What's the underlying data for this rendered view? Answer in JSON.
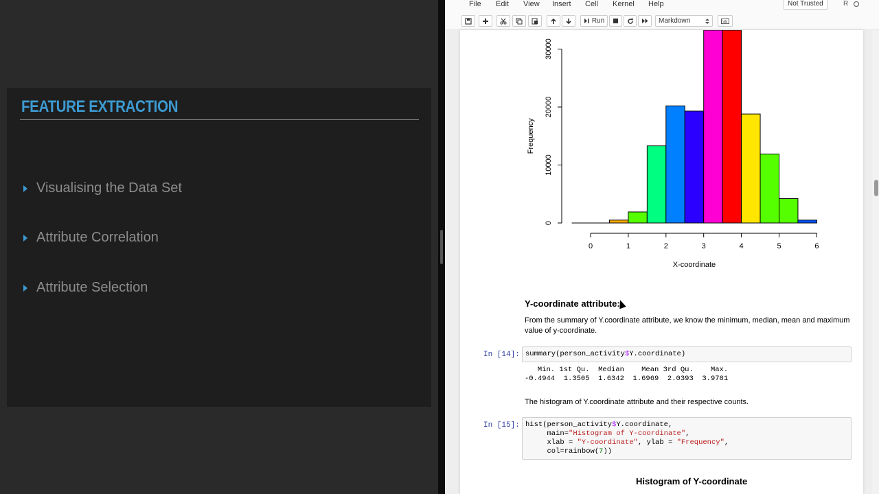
{
  "slide": {
    "title": "FEATURE EXTRACTION",
    "bullets": [
      "Visualising the Data Set",
      "Attribute Correlation",
      "Attribute Selection"
    ]
  },
  "menubar": {
    "items": [
      "File",
      "Edit",
      "View",
      "Insert",
      "Cell",
      "Kernel",
      "Help"
    ],
    "trusted": "Not Trusted",
    "kernel": "R"
  },
  "toolbar": {
    "run_label": "Run",
    "cell_type": "Markdown",
    "icons": [
      "save-icon",
      "plus-icon",
      "cut-icon",
      "copy-icon",
      "paste-icon",
      "arrow-up-icon",
      "arrow-down-icon",
      "run-icon",
      "stop-icon",
      "restart-icon",
      "fast-forward-icon",
      "keyboard-icon"
    ]
  },
  "chart_data": {
    "type": "bar",
    "title": "",
    "xlabel": "X-coordinate",
    "ylabel": "Frequency",
    "bin_edges": [
      0,
      0.5,
      1,
      1.5,
      2,
      2.5,
      3,
      3.5,
      4,
      4.5,
      5,
      5.5,
      6
    ],
    "values": [
      0,
      500,
      1900,
      13300,
      20200,
      19300,
      34000,
      34000,
      18800,
      11900,
      4200,
      500
    ],
    "colors": [
      "#FFFFFF",
      "#FFAA00",
      "#55FF00",
      "#00FF80",
      "#0080FF",
      "#2B00FF",
      "#FF00D4",
      "#FF0000",
      "#FFE600",
      "#55FF00",
      "#55FF00",
      "#0055FF"
    ],
    "xticks": [
      "0",
      "1",
      "2",
      "3",
      "4",
      "5",
      "6"
    ],
    "yticks": [
      "0",
      "10000",
      "20000",
      "30000"
    ],
    "xlim": [
      0,
      6
    ]
  },
  "cells": {
    "heading": "Y-coordinate attribute:",
    "summary_text": "From the summary of Y.coordinate attribute, we know the minimum, median, mean and maximum value of y-coordinate.",
    "in14_prompt": "In [14]:",
    "in14_code_pre": "summary(person_activity",
    "in14_code_op": "$",
    "in14_code_post": "Y.coordinate)",
    "out14_line1": "   Min. 1st Qu.  Median    Mean 3rd Qu.    Max. ",
    "out14_line2": "-0.4944  1.3505  1.6342  1.6969  2.0393  3.9781 ",
    "hist_text": "The histogram of Y.coordinate attribute and their respective counts.",
    "in15_prompt": "In [15]:",
    "in15_l1_pre": "hist(person_activity",
    "in15_l1_op": "$",
    "in15_l1_post": "Y.coordinate,",
    "in15_l2_pre": "     main=",
    "in15_l2_str": "\"Histogram of Y-coordinate\"",
    "in15_l2_post": ",",
    "in15_l3_pre": "     xlab = ",
    "in15_l3_str1": "\"Y-coordinate\"",
    "in15_l3_mid": ", ylab = ",
    "in15_l3_str2": "\"Frequency\"",
    "in15_l3_post": ",",
    "in15_l4_pre": "     col=rainbow(",
    "in15_l4_num": "7",
    "in15_l4_post": "))",
    "plot2_title": "Histogram of Y-coordinate"
  }
}
